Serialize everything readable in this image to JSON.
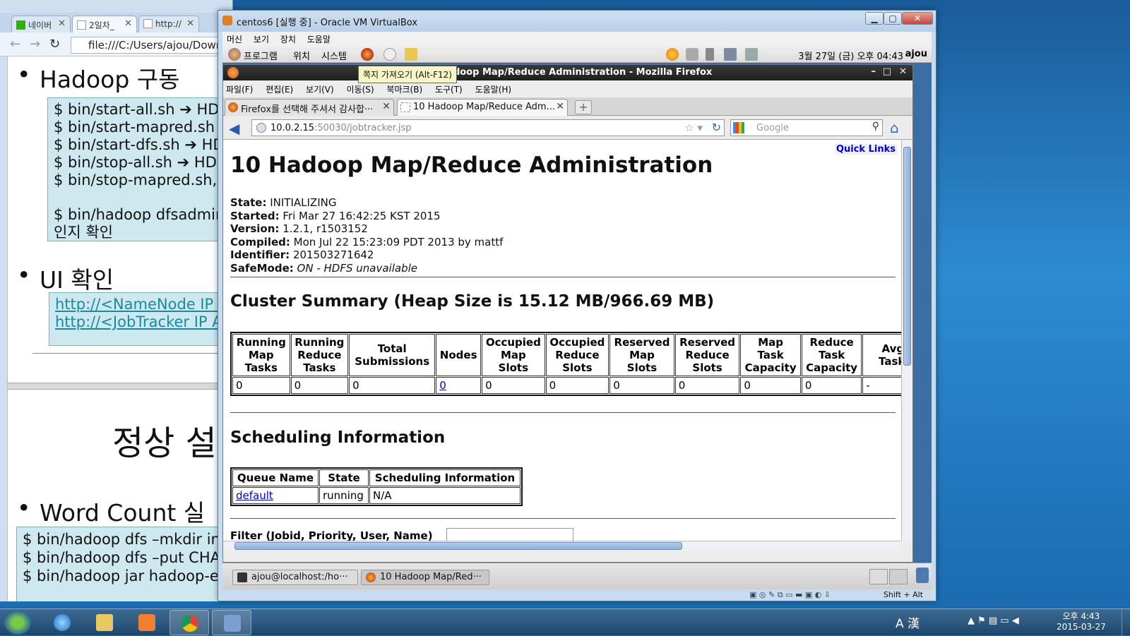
{
  "chrome": {
    "tabs": [
      "네이버",
      "2일차_",
      "http://"
    ],
    "url": "file:///C:/Users/ajou/Down"
  },
  "doc": {
    "bullet1": "Hadoop 구동",
    "code1": [
      "$ bin/start-all.sh ➔ HDFS",
      "$ bin/start-mapred.sh ➔",
      "$ bin/start-dfs.sh ➔ HDF",
      "$ bin/stop-all.sh ➔ HDFS",
      "$ bin/stop-mapred.sh, bi",
      "",
      "$ bin/hadoop dfsadmin -",
      "인지 확인"
    ],
    "bullet2": "UI 확인",
    "links": [
      "http://<NameNode IP Ad",
      "http://<JobTracker IP Add"
    ],
    "heading": "정상 설",
    "bullet3": "Word Count 실",
    "code2": [
      "$ bin/hadoop dfs –mkdir inpu",
      "$ bin/hadoop dfs –put CHAN",
      "$ bin/hadoop jar hadoop-exa"
    ]
  },
  "vbox": {
    "title": "centos6 [실행 중] - Oracle VM VirtualBox",
    "menu": [
      "머신",
      "보기",
      "장치",
      "도움말"
    ],
    "host_key": "Shift + Alt"
  },
  "gnome": {
    "menus": [
      "프로그램",
      "위치",
      "시스템"
    ],
    "clock": "3월 27일 (금) 오후 04:43",
    "user": "ajou",
    "tooltip": "쪽지 가져오기 (Alt-F12)",
    "tasks": [
      "ajou@localhost:/ho···",
      "10 Hadoop Map/Red···"
    ]
  },
  "firefox": {
    "title": "10 Hadoop Map/Reduce Administration - Mozilla Firefox",
    "menu": [
      "파일(F)",
      "편집(E)",
      "보기(V)",
      "이동(S)",
      "북마크(B)",
      "도구(T)",
      "도움말(H)"
    ],
    "tabs": [
      "Firefox를 선택해 주셔서 감사합···",
      "10 Hadoop Map/Reduce Adm..."
    ],
    "url_host": "10.0.2.15",
    "url_rest": ":50030/jobtracker.jsp",
    "search_placeholder": "Google"
  },
  "page": {
    "quick_links": "Quick Links",
    "title": "10 Hadoop Map/Reduce Administration",
    "info": {
      "state_label": "State:",
      "state": "INITIALIZING",
      "started_label": "Started:",
      "started": "Fri Mar 27 16:42:25 KST 2015",
      "version_label": "Version:",
      "version": "1.2.1, r1503152",
      "compiled_label": "Compiled:",
      "compiled": "Mon Jul 22 15:23:09 PDT 2013 by mattf",
      "identifier_label": "Identifier:",
      "identifier": "201503271642",
      "safemode_label": "SafeMode:",
      "safemode": "ON - HDFS unavailable"
    },
    "cluster_heading": "Cluster Summary (Heap Size is 15.12 MB/966.69 MB)",
    "cluster_headers": [
      "Running Map Tasks",
      "Running Reduce Tasks",
      "Total Submissions",
      "Nodes",
      "Occupied Map Slots",
      "Occupied Reduce Slots",
      "Reserved Map Slots",
      "Reserved Reduce Slots",
      "Map Task Capacity",
      "Reduce Task Capacity",
      "Avg. Tasks"
    ],
    "cluster_values": [
      "0",
      "0",
      "0",
      "0",
      "0",
      "0",
      "0",
      "0",
      "0",
      "0",
      "-"
    ],
    "sched_heading": "Scheduling Information",
    "sched_headers": [
      "Queue Name",
      "State",
      "Scheduling Information"
    ],
    "sched_row": [
      "default",
      "running",
      "N/A"
    ],
    "filter_label": "Filter (Jobid, Priority, User, Name)"
  },
  "taskbar": {
    "ime": "A 漢",
    "time": "오후 4:43",
    "date": "2015-03-27"
  }
}
